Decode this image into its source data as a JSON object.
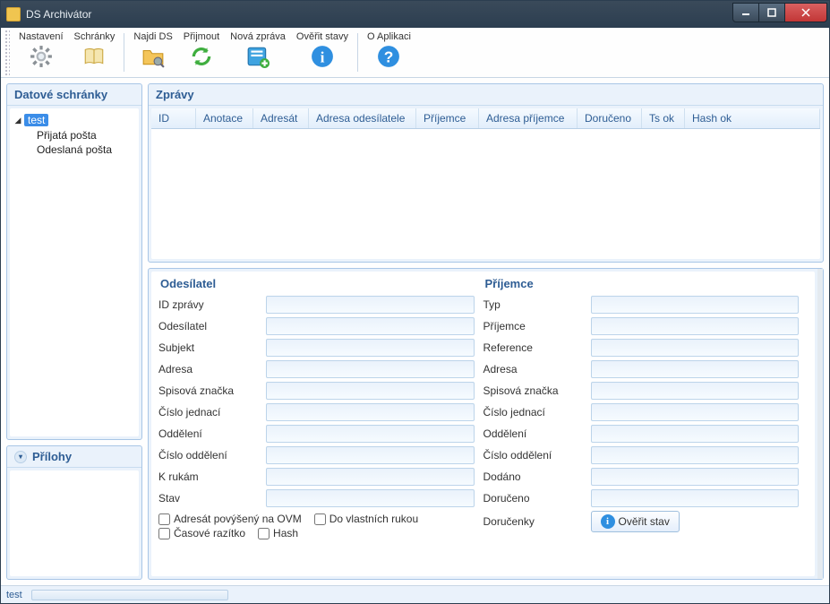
{
  "window": {
    "title": "DS Archivátor"
  },
  "toolbar": {
    "settings": "Nastavení",
    "mailboxes": "Schránky",
    "find_ds": "Najdi DS",
    "receive": "Přijmout",
    "new_message": "Nová zpráva",
    "verify_states": "Ověřit stavy",
    "about": "O Aplikaci"
  },
  "sidebar": {
    "mailboxes_title": "Datové schránky",
    "tree": {
      "root": "test",
      "inbox": "Přijatá pošta",
      "sent": "Odeslaná pošta"
    },
    "attachments_title": "Přílohy"
  },
  "messages": {
    "title": "Zprávy",
    "columns": [
      "ID",
      "Anotace",
      "Adresát",
      "Adresa odesílatele",
      "Příjemce",
      "Adresa příjemce",
      "Doručeno",
      "Ts ok",
      "Hash ok"
    ]
  },
  "details": {
    "sender": {
      "title": "Odesílatel",
      "fields": {
        "id": "ID zprávy",
        "sender": "Odesílatel",
        "subject": "Subjekt",
        "address": "Adresa",
        "file_mark": "Spisová značka",
        "ref_number": "Číslo jednací",
        "department": "Oddělení",
        "dept_number": "Číslo oddělení",
        "to_hands": "K rukám",
        "state": "Stav"
      },
      "checkboxes": {
        "ovm": "Adresát povýšený na OVM",
        "own_hands": "Do vlastních rukou",
        "timestamp": "Časové razítko",
        "hash": "Hash"
      }
    },
    "recipient": {
      "title": "Příjemce",
      "fields": {
        "type": "Typ",
        "recipient": "Příjemce",
        "reference": "Reference",
        "address": "Adresa",
        "file_mark": "Spisová značka",
        "ref_number": "Číslo jednací",
        "department": "Oddělení",
        "dept_number": "Číslo oddělení",
        "delivered": "Dodáno",
        "received": "Doručeno",
        "acknowledgements": "Doručenky"
      },
      "verify_button": "Ověřit stav"
    }
  },
  "statusbar": {
    "text": "test"
  }
}
